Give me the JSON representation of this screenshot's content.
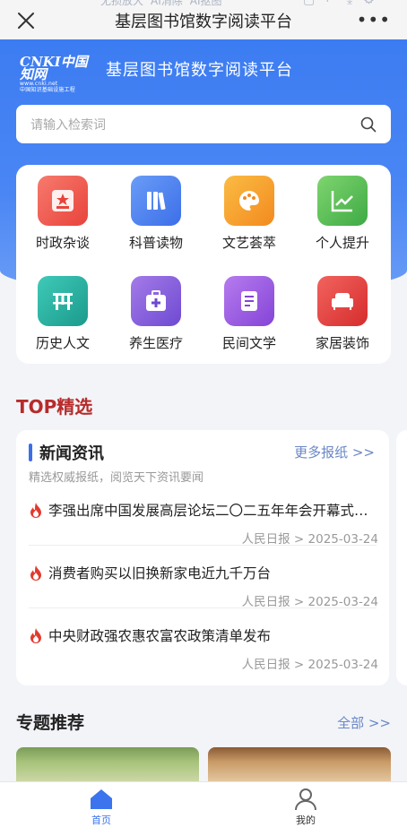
{
  "browser": {
    "title": "基层图书馆数字阅读平台",
    "tools": [
      "无损放大",
      "AI消除",
      "AI抠图"
    ]
  },
  "header": {
    "logo_main": "CNKI中国知网",
    "logo_url": "www.cnki.net",
    "logo_sub": "中国知识基础设施工程",
    "title": "基层图书馆数字阅读平台"
  },
  "search": {
    "placeholder": "请输入检索词"
  },
  "categories": [
    {
      "label": "时政杂谈",
      "icon": "politics-icon",
      "color": "#ef5a52"
    },
    {
      "label": "科普读物",
      "icon": "books-icon",
      "color": "#4a7df0"
    },
    {
      "label": "文艺荟萃",
      "icon": "palette-icon",
      "color": "#f5a22a"
    },
    {
      "label": "个人提升",
      "icon": "growth-chart-icon",
      "color": "#5cc25a"
    },
    {
      "label": "历史人文",
      "icon": "pavilion-icon",
      "color": "#27b3a4"
    },
    {
      "label": "养生医疗",
      "icon": "medkit-icon",
      "color": "#8a5fe0"
    },
    {
      "label": "民间文学",
      "icon": "document-icon",
      "color": "#9a56e0"
    },
    {
      "label": "家居装饰",
      "icon": "sofa-icon",
      "color": "#ea4343"
    }
  ],
  "top": {
    "title": "TOP精选",
    "card_title": "新闻资讯",
    "more": "更多报纸 >>",
    "subtitle": "精选权威报纸，阅览天下资讯要闻",
    "items": [
      {
        "headline": "李强出席中国发展高层论坛二〇二五年年会开幕式并发表主旨演讲",
        "meta": "人民日报 > 2025-03-24"
      },
      {
        "headline": "消费者购买以旧换新家电近九千万台",
        "meta": "人民日报 > 2025-03-24"
      },
      {
        "headline": "中央财政强农惠农富农政策清单发布",
        "meta": "人民日报 > 2025-03-24"
      }
    ]
  },
  "topics": {
    "title": "专题推荐",
    "more": "全部 >>"
  },
  "nav": {
    "home": "首页",
    "mine": "我的"
  },
  "colors": {
    "primary": "#3c7cf2",
    "accent_red": "#b72b2b",
    "link": "#6a87c6"
  }
}
